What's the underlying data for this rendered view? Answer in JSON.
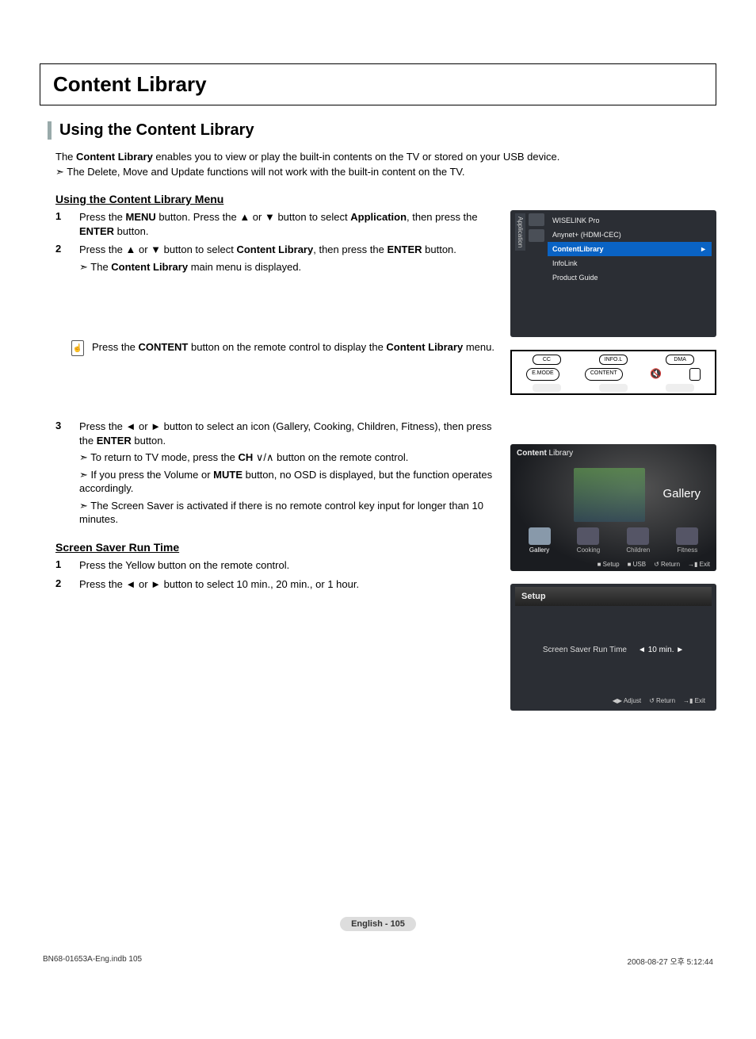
{
  "title": "Content Library",
  "section_title": "Using the Content Library",
  "intro_prefix": "The ",
  "intro_bold": "Content Library",
  "intro_suffix": " enables you to view or play the built-in contents on the TV or stored on your USB device.",
  "intro_note": "The Delete, Move and Update functions will not work with the built-in content on the TV.",
  "subhead1": "Using the Content Library Menu",
  "step1": {
    "num": "1",
    "p1a": "Press the ",
    "p1b": "MENU",
    "p1c": " button. Press the ▲ or ▼ button to select ",
    "p1d": "Application",
    "p1e": ", then press the ",
    "p1f": "ENTER",
    "p1g": " button."
  },
  "step2": {
    "num": "2",
    "p1a": "Press the ▲ or ▼ button to select ",
    "p1b": "Content Library",
    "p1c": ", then press the ",
    "p1d": "ENTER",
    "p1e": " button.",
    "note_a": "The ",
    "note_b": "Content Library",
    "note_c": " main menu is displayed."
  },
  "remote_tip_a": "Press the ",
  "remote_tip_b": "CONTENT",
  "remote_tip_c": " button on the remote control to display the ",
  "remote_tip_d": "Content Library",
  "remote_tip_e": " menu.",
  "step3": {
    "num": "3",
    "p1a": "Press the ◄ or ► button to select an icon (Gallery, Cooking, Children, Fitness), then press the  ",
    "p1b": "ENTER",
    "p1c": " button.",
    "n1a": "To return to TV mode, press the ",
    "n1b": "CH",
    "n1c": " ∨/∧ button on the remote control.",
    "n2a": "If you press the Volume or ",
    "n2b": "MUTE",
    "n2c": " button, no OSD is displayed, but the function operates accordingly.",
    "n3": "The Screen Saver is activated if there is no remote control key input for longer than 10 minutes."
  },
  "subhead2": "Screen Saver Run Time",
  "ss_step1": {
    "num": "1",
    "txt": "Press the Yellow button on the remote control."
  },
  "ss_step2": {
    "num": "2",
    "txt": "Press the ◄ or ► button to select 10 min., 20 min., or 1 hour."
  },
  "osd1": {
    "sidebar": "Application",
    "items": [
      "WISELINK Pro",
      "Anynet+ (HDMI-CEC)",
      "ContentLibrary",
      "InfoLink",
      "Product Guide"
    ],
    "selected_index": 2
  },
  "remote_buttons": {
    "row1": [
      "CC",
      "INFO.L",
      "DMA"
    ],
    "row2": [
      "E.MODE",
      "CONTENT"
    ]
  },
  "osd2": {
    "title_a": "Content",
    "title_b": " Library",
    "big_label": "Gallery",
    "cats": [
      "Gallery",
      "Cooking",
      "Children",
      "Fitness"
    ],
    "selected_index": 0,
    "bottom": [
      "Setup",
      "USB",
      "Return",
      "Exit"
    ]
  },
  "osd3": {
    "title": "Setup",
    "label": "Screen Saver Run Time",
    "value": "10 min.",
    "bottom": [
      "Adjust",
      "Return",
      "Exit"
    ]
  },
  "page_num": "English - 105",
  "footer_left": "BN68-01653A-Eng.indb   105",
  "footer_right": "2008-08-27   오후 5:12:44"
}
